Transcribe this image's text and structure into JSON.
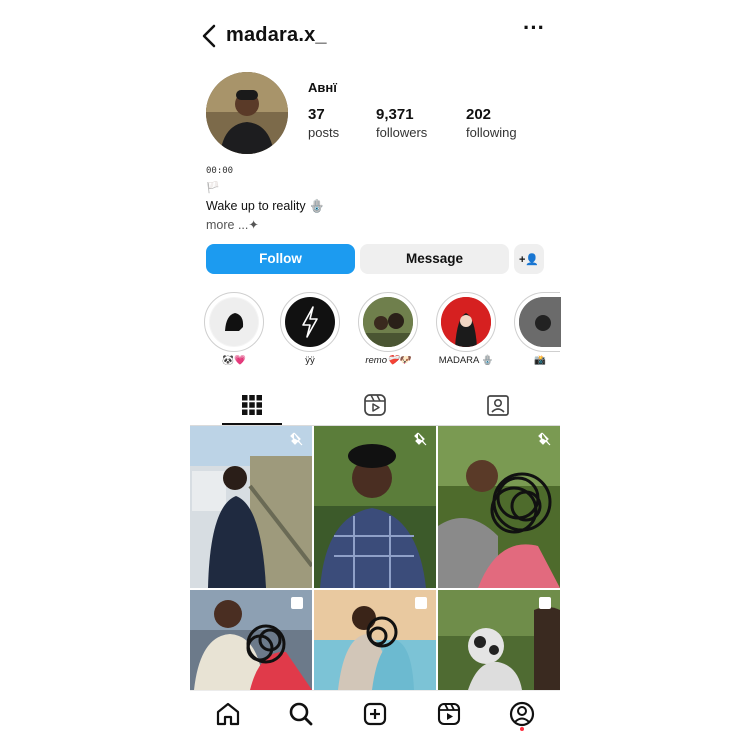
{
  "header": {
    "username": "madara.x_",
    "more_label": "···"
  },
  "profile": {
    "display_name": "Авнї",
    "posts_count": "37",
    "posts_label": "posts",
    "followers_count": "9,371",
    "followers_label": "followers",
    "following_count": "202",
    "following_label": "following"
  },
  "bio": {
    "line1": "00:00",
    "line2": "🏳️",
    "line3": "Wake up to reality 🪬",
    "more": "more ...✦"
  },
  "actions": {
    "follow_label": "Follow",
    "message_label": "Message",
    "add_user_icon": "+👤"
  },
  "highlights": [
    {
      "label": "🐼💗"
    },
    {
      "label": "ÿÿ"
    },
    {
      "label": "remo❤️‍🩹🐶"
    },
    {
      "label": "MADARA 🪬"
    },
    {
      "label": "📸"
    }
  ],
  "tabs": [
    "posts-grid",
    "reels",
    "tagged"
  ],
  "colors": {
    "accent": "#1c9bf0",
    "secondary_button": "#efefef",
    "notification": "#ff3040"
  }
}
